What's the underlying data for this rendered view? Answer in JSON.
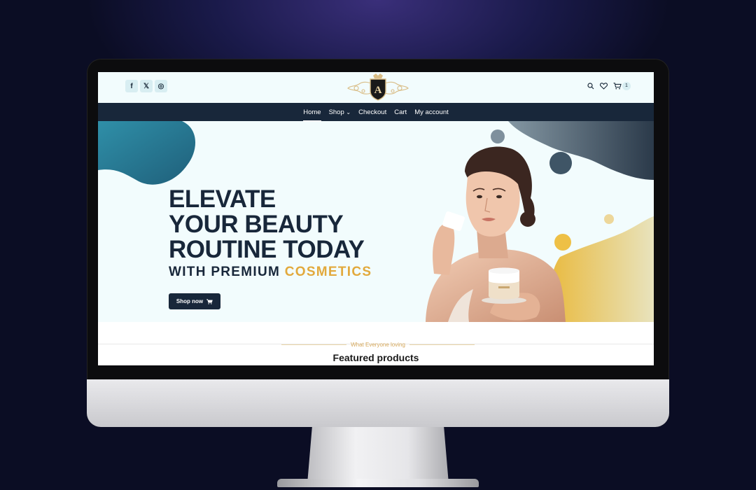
{
  "header": {
    "social": [
      {
        "icon": "facebook-icon",
        "glyph": "f"
      },
      {
        "icon": "x-icon",
        "glyph": "𝕏"
      },
      {
        "icon": "instagram-icon",
        "glyph": "◎"
      }
    ],
    "logo_letter": "A",
    "cart_count": "1"
  },
  "nav": {
    "items": [
      {
        "label": "Home"
      },
      {
        "label": "Shop",
        "caret": "⌄"
      },
      {
        "label": "Checkout"
      },
      {
        "label": "Cart"
      },
      {
        "label": "My account"
      }
    ]
  },
  "hero": {
    "headline_1": "ELEVATE",
    "headline_2": "YOUR BEAUTY",
    "headline_3": "ROUTINE TODAY",
    "sub_lead": "WITH PREMIUM ",
    "sub_accent": "COSMETICS",
    "button_label": "Shop now"
  },
  "featured": {
    "eyebrow": "What Everyone loving",
    "title": "Featured products"
  },
  "colors": {
    "navy": "#18273a",
    "gold": "#e2a93c",
    "hero_bg": "#f2fcfd"
  }
}
